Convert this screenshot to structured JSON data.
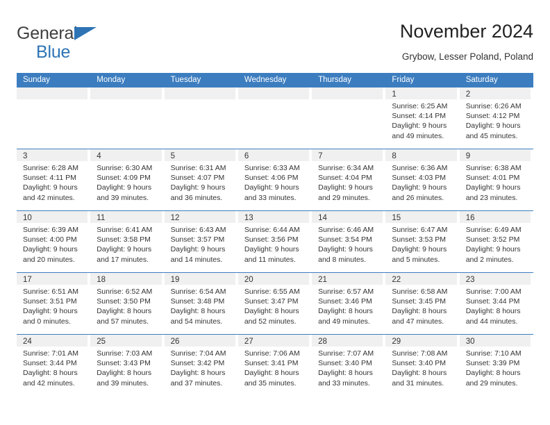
{
  "brand": {
    "name_part1": "General",
    "name_part2": "Blue",
    "triangle_icon": "blue-triangle-logo-icon",
    "accent_color": "#2E74B5"
  },
  "header": {
    "title": "November 2024",
    "subtitle": "Grybow, Lesser Poland, Poland"
  },
  "calendar": {
    "header_color": "#3C7DBF",
    "daynum_band_color": "#F0F0F0",
    "weekdays": [
      "Sunday",
      "Monday",
      "Tuesday",
      "Wednesday",
      "Thursday",
      "Friday",
      "Saturday"
    ],
    "weeks": [
      [
        {
          "day": "",
          "lines": []
        },
        {
          "day": "",
          "lines": []
        },
        {
          "day": "",
          "lines": []
        },
        {
          "day": "",
          "lines": []
        },
        {
          "day": "",
          "lines": []
        },
        {
          "day": "1",
          "lines": [
            "Sunrise: 6:25 AM",
            "Sunset: 4:14 PM",
            "Daylight: 9 hours",
            "and 49 minutes."
          ]
        },
        {
          "day": "2",
          "lines": [
            "Sunrise: 6:26 AM",
            "Sunset: 4:12 PM",
            "Daylight: 9 hours",
            "and 45 minutes."
          ]
        }
      ],
      [
        {
          "day": "3",
          "lines": [
            "Sunrise: 6:28 AM",
            "Sunset: 4:11 PM",
            "Daylight: 9 hours",
            "and 42 minutes."
          ]
        },
        {
          "day": "4",
          "lines": [
            "Sunrise: 6:30 AM",
            "Sunset: 4:09 PM",
            "Daylight: 9 hours",
            "and 39 minutes."
          ]
        },
        {
          "day": "5",
          "lines": [
            "Sunrise: 6:31 AM",
            "Sunset: 4:07 PM",
            "Daylight: 9 hours",
            "and 36 minutes."
          ]
        },
        {
          "day": "6",
          "lines": [
            "Sunrise: 6:33 AM",
            "Sunset: 4:06 PM",
            "Daylight: 9 hours",
            "and 33 minutes."
          ]
        },
        {
          "day": "7",
          "lines": [
            "Sunrise: 6:34 AM",
            "Sunset: 4:04 PM",
            "Daylight: 9 hours",
            "and 29 minutes."
          ]
        },
        {
          "day": "8",
          "lines": [
            "Sunrise: 6:36 AM",
            "Sunset: 4:03 PM",
            "Daylight: 9 hours",
            "and 26 minutes."
          ]
        },
        {
          "day": "9",
          "lines": [
            "Sunrise: 6:38 AM",
            "Sunset: 4:01 PM",
            "Daylight: 9 hours",
            "and 23 minutes."
          ]
        }
      ],
      [
        {
          "day": "10",
          "lines": [
            "Sunrise: 6:39 AM",
            "Sunset: 4:00 PM",
            "Daylight: 9 hours",
            "and 20 minutes."
          ]
        },
        {
          "day": "11",
          "lines": [
            "Sunrise: 6:41 AM",
            "Sunset: 3:58 PM",
            "Daylight: 9 hours",
            "and 17 minutes."
          ]
        },
        {
          "day": "12",
          "lines": [
            "Sunrise: 6:43 AM",
            "Sunset: 3:57 PM",
            "Daylight: 9 hours",
            "and 14 minutes."
          ]
        },
        {
          "day": "13",
          "lines": [
            "Sunrise: 6:44 AM",
            "Sunset: 3:56 PM",
            "Daylight: 9 hours",
            "and 11 minutes."
          ]
        },
        {
          "day": "14",
          "lines": [
            "Sunrise: 6:46 AM",
            "Sunset: 3:54 PM",
            "Daylight: 9 hours",
            "and 8 minutes."
          ]
        },
        {
          "day": "15",
          "lines": [
            "Sunrise: 6:47 AM",
            "Sunset: 3:53 PM",
            "Daylight: 9 hours",
            "and 5 minutes."
          ]
        },
        {
          "day": "16",
          "lines": [
            "Sunrise: 6:49 AM",
            "Sunset: 3:52 PM",
            "Daylight: 9 hours",
            "and 2 minutes."
          ]
        }
      ],
      [
        {
          "day": "17",
          "lines": [
            "Sunrise: 6:51 AM",
            "Sunset: 3:51 PM",
            "Daylight: 9 hours",
            "and 0 minutes."
          ]
        },
        {
          "day": "18",
          "lines": [
            "Sunrise: 6:52 AM",
            "Sunset: 3:50 PM",
            "Daylight: 8 hours",
            "and 57 minutes."
          ]
        },
        {
          "day": "19",
          "lines": [
            "Sunrise: 6:54 AM",
            "Sunset: 3:48 PM",
            "Daylight: 8 hours",
            "and 54 minutes."
          ]
        },
        {
          "day": "20",
          "lines": [
            "Sunrise: 6:55 AM",
            "Sunset: 3:47 PM",
            "Daylight: 8 hours",
            "and 52 minutes."
          ]
        },
        {
          "day": "21",
          "lines": [
            "Sunrise: 6:57 AM",
            "Sunset: 3:46 PM",
            "Daylight: 8 hours",
            "and 49 minutes."
          ]
        },
        {
          "day": "22",
          "lines": [
            "Sunrise: 6:58 AM",
            "Sunset: 3:45 PM",
            "Daylight: 8 hours",
            "and 47 minutes."
          ]
        },
        {
          "day": "23",
          "lines": [
            "Sunrise: 7:00 AM",
            "Sunset: 3:44 PM",
            "Daylight: 8 hours",
            "and 44 minutes."
          ]
        }
      ],
      [
        {
          "day": "24",
          "lines": [
            "Sunrise: 7:01 AM",
            "Sunset: 3:44 PM",
            "Daylight: 8 hours",
            "and 42 minutes."
          ]
        },
        {
          "day": "25",
          "lines": [
            "Sunrise: 7:03 AM",
            "Sunset: 3:43 PM",
            "Daylight: 8 hours",
            "and 39 minutes."
          ]
        },
        {
          "day": "26",
          "lines": [
            "Sunrise: 7:04 AM",
            "Sunset: 3:42 PM",
            "Daylight: 8 hours",
            "and 37 minutes."
          ]
        },
        {
          "day": "27",
          "lines": [
            "Sunrise: 7:06 AM",
            "Sunset: 3:41 PM",
            "Daylight: 8 hours",
            "and 35 minutes."
          ]
        },
        {
          "day": "28",
          "lines": [
            "Sunrise: 7:07 AM",
            "Sunset: 3:40 PM",
            "Daylight: 8 hours",
            "and 33 minutes."
          ]
        },
        {
          "day": "29",
          "lines": [
            "Sunrise: 7:08 AM",
            "Sunset: 3:40 PM",
            "Daylight: 8 hours",
            "and 31 minutes."
          ]
        },
        {
          "day": "30",
          "lines": [
            "Sunrise: 7:10 AM",
            "Sunset: 3:39 PM",
            "Daylight: 8 hours",
            "and 29 minutes."
          ]
        }
      ]
    ]
  }
}
